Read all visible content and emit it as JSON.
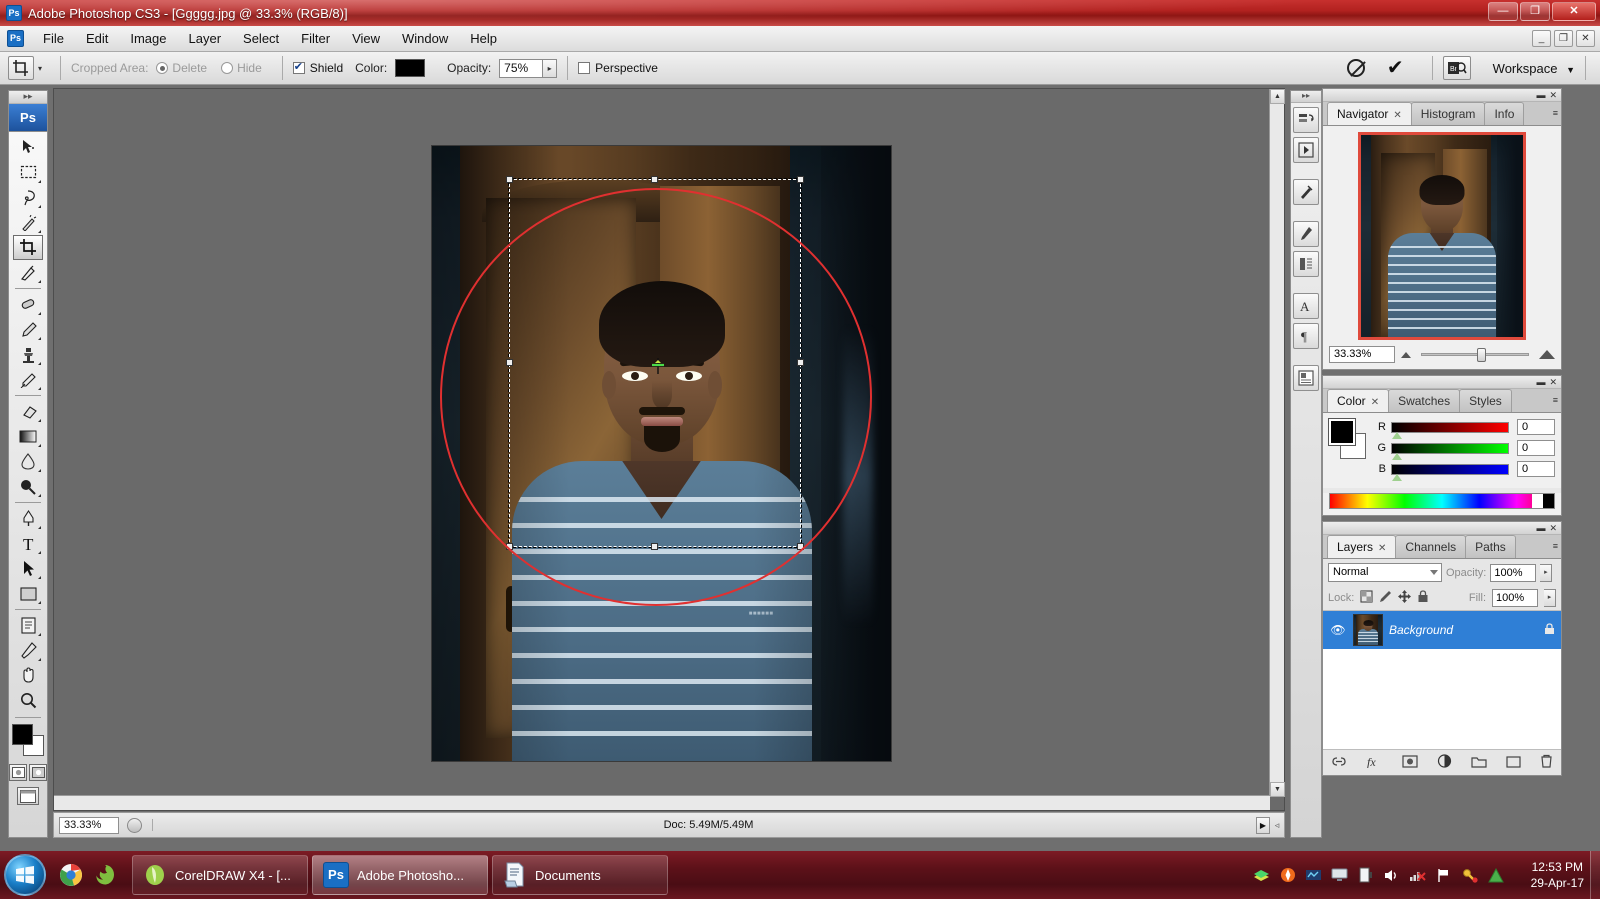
{
  "titlebar": {
    "app_title": "Adobe Photoshop CS3 - [Ggggg.jpg @ 33.3% (RGB/8)]",
    "app_icon": "photoshop-icon",
    "minimize": "—",
    "maximize": "❐",
    "close": "✕"
  },
  "menubar": {
    "app_icon": "photoshop-doc-icon",
    "items": [
      {
        "label": "File"
      },
      {
        "label": "Edit"
      },
      {
        "label": "Image"
      },
      {
        "label": "Layer"
      },
      {
        "label": "Select"
      },
      {
        "label": "Filter"
      },
      {
        "label": "View"
      },
      {
        "label": "Window"
      },
      {
        "label": "Help"
      }
    ],
    "doc_minimize": "_",
    "doc_restore": "❐",
    "doc_close": "✕"
  },
  "options_bar": {
    "tool_icon": "crop-tool-icon",
    "preset_arrow": "▾",
    "cropped_area_label": "Cropped Area:",
    "delete_label": "Delete",
    "hide_label": "Hide",
    "delete_selected": true,
    "shield_label": "Shield",
    "shield_checked": true,
    "color_label": "Color:",
    "color_value": "#000000",
    "opacity_label": "Opacity:",
    "opacity_value": "75%",
    "opacity_spin": "▸",
    "perspective_label": "Perspective",
    "perspective_checked": false,
    "cancel_icon": "cancel-crop-icon",
    "commit_icon": "commit-crop-checkmark-icon",
    "bridge_icon": "go-to-bridge-icon",
    "workspace_label": "Workspace",
    "workspace_arrow": "▼"
  },
  "toolbar": {
    "logo": "Ps",
    "grip": "▸▸",
    "tools": [
      {
        "name": "move-tool",
        "selected": false
      },
      {
        "name": "rectangular-marquee-tool",
        "selected": false
      },
      {
        "name": "lasso-tool",
        "selected": false
      },
      {
        "name": "magic-wand-tool",
        "selected": false
      },
      {
        "name": "crop-tool",
        "selected": true
      },
      {
        "name": "slice-tool",
        "selected": false
      },
      {
        "name": "healing-brush-tool",
        "selected": false
      },
      {
        "name": "brush-tool",
        "selected": false
      },
      {
        "name": "clone-stamp-tool",
        "selected": false
      },
      {
        "name": "history-brush-tool",
        "selected": false
      },
      {
        "name": "eraser-tool",
        "selected": false
      },
      {
        "name": "gradient-tool",
        "selected": false
      },
      {
        "name": "blur-tool",
        "selected": false
      },
      {
        "name": "dodge-tool",
        "selected": false
      },
      {
        "name": "pen-tool",
        "selected": false
      },
      {
        "name": "type-tool",
        "selected": false
      },
      {
        "name": "path-selection-tool",
        "selected": false
      },
      {
        "name": "rectangle-shape-tool",
        "selected": false
      },
      {
        "name": "notes-tool",
        "selected": false
      },
      {
        "name": "eyedropper-tool",
        "selected": false
      },
      {
        "name": "hand-tool",
        "selected": false
      },
      {
        "name": "zoom-tool",
        "selected": false
      }
    ],
    "foreground_color": "#000000",
    "background_color": "#ffffff",
    "annotation": "red-ellipse-highlight-on-crop-tool"
  },
  "canvas": {
    "document_name": "Ggggg.jpg",
    "zoom": "33.3%",
    "mode": "RGB/8",
    "crop_selection_active": true,
    "handles": 8,
    "annotation_shape": "red-ellipse"
  },
  "statusbar": {
    "zoom_value": "33.33%",
    "doc_info": "Doc: 5.49M/5.49M",
    "arrow": "▶",
    "resize_grip": "◃"
  },
  "navigator_panel": {
    "tabs": [
      {
        "label": "Navigator",
        "active": true,
        "closable": true
      },
      {
        "label": "Histogram",
        "active": false,
        "closable": false
      },
      {
        "label": "Info",
        "active": false,
        "closable": false
      }
    ],
    "zoom_value": "33.33%",
    "zoom_out_icon": "small-mountain-icon",
    "zoom_in_icon": "large-mountain-icon",
    "collapse": "▬",
    "close": "✕",
    "menu": "≡"
  },
  "color_panel": {
    "tabs": [
      {
        "label": "Color",
        "active": true,
        "closable": true
      },
      {
        "label": "Swatches",
        "active": false,
        "closable": false
      },
      {
        "label": "Styles",
        "active": false,
        "closable": false
      }
    ],
    "channels": [
      {
        "label": "R",
        "value": "0"
      },
      {
        "label": "G",
        "value": "0"
      },
      {
        "label": "B",
        "value": "0"
      }
    ],
    "foreground_color": "#000000",
    "background_color": "#ffffff",
    "collapse": "▬",
    "close": "✕",
    "menu": "≡"
  },
  "layers_panel": {
    "tabs": [
      {
        "label": "Layers",
        "active": true,
        "closable": true
      },
      {
        "label": "Channels",
        "active": false,
        "closable": false
      },
      {
        "label": "Paths",
        "active": false,
        "closable": false
      }
    ],
    "blend_mode": "Normal",
    "opacity_label": "Opacity:",
    "opacity_value": "100%",
    "lock_label": "Lock:",
    "lock_icons": [
      "lock-transparency-icon",
      "lock-image-icon",
      "lock-position-icon",
      "lock-all-icon"
    ],
    "fill_label": "Fill:",
    "fill_value": "100%",
    "layers": [
      {
        "name": "Background",
        "visible": true,
        "locked": true,
        "selected": true
      }
    ],
    "footer_icons": [
      "link-layers-icon",
      "layer-style-fx-icon",
      "layer-mask-icon",
      "adjustment-layer-icon",
      "new-group-icon",
      "new-layer-icon",
      "delete-layer-icon"
    ],
    "collapse": "▬",
    "close": "✕",
    "menu": "≡"
  },
  "icon_dock": {
    "buttons": [
      "history-icon",
      "actions-icon",
      "tool-presets-icon",
      "brushes-icon",
      "clone-source-icon",
      "character-icon",
      "paragraph-icon",
      "layer-comps-icon"
    ],
    "expand_arrow": "▸▸"
  },
  "taskbar": {
    "start_button": "windows-start-orb",
    "quick_launch": [
      "chrome-icon",
      "firefox-icon"
    ],
    "tasks": [
      {
        "label": "CorelDRAW X4 - [...",
        "icon": "coreldraw-icon",
        "active": false
      },
      {
        "label": "Adobe Photosho...",
        "icon": "photoshop-icon",
        "active": true
      },
      {
        "label": "Documents",
        "icon": "documents-folder-icon",
        "active": false
      }
    ],
    "tray_icons": [
      "books-icon",
      "avast-icon",
      "network-monitor-icon",
      "display-icon",
      "battery-icon",
      "volume-icon",
      "network-disconnected-icon",
      "action-center-flag-icon",
      "key-warning-icon",
      "triangle-green-icon"
    ],
    "clock_time": "12:53 PM",
    "clock_date": "29-Apr-17"
  }
}
